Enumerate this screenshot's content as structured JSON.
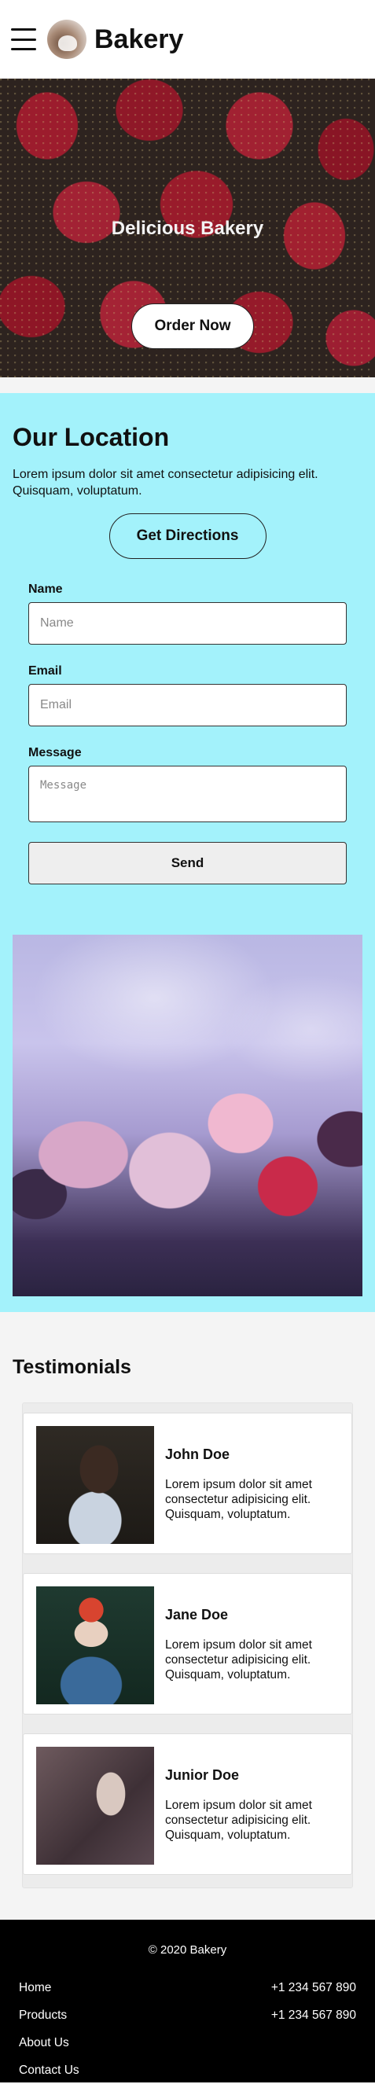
{
  "header": {
    "menu_icon": "hamburger-menu-icon",
    "logo_icon": "bakery-logo",
    "brand": "Bakery"
  },
  "hero": {
    "title": "Delicious Bakery",
    "cta": "Order Now"
  },
  "location": {
    "title": "Our Location",
    "description": "Lorem ipsum dolor sit amet consectetur adipisicing elit. Quisquam, voluptatum.",
    "directions_button": "Get Directions",
    "form": {
      "name_label": "Name",
      "name_placeholder": "Name",
      "email_label": "Email",
      "email_placeholder": "Email",
      "message_label": "Message",
      "message_placeholder": "Message",
      "send_button": "Send"
    }
  },
  "testimonials": {
    "title": "Testimonials",
    "items": [
      {
        "name": "John Doe",
        "text": "Lorem ipsum dolor sit amet consectetur adipisicing elit. Quisquam, voluptatum."
      },
      {
        "name": "Jane Doe",
        "text": "Lorem ipsum dolor sit amet consectetur adipisicing elit. Quisquam, voluptatum."
      },
      {
        "name": "Junior Doe",
        "text": "Lorem ipsum dolor sit amet consectetur adipisicing elit. Quisquam, voluptatum."
      }
    ]
  },
  "footer": {
    "copyright": "© 2020 Bakery",
    "links": [
      "Home",
      "Products",
      "About Us",
      "Contact Us"
    ],
    "phones": [
      "+1 234 567 890",
      "+1 234 567 890"
    ]
  },
  "colors": {
    "location_bg": "#a3f2fb",
    "page_bg": "#f4f4f4",
    "footer_bg": "#000000"
  }
}
